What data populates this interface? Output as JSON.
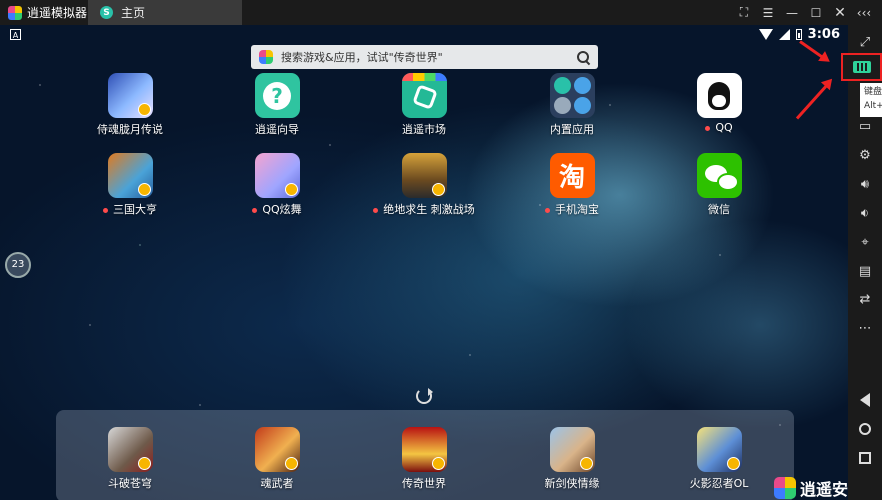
{
  "titlebar": {
    "app_name": "逍遥模拟器",
    "tab_label": "主页",
    "tab_icon_letter": "S",
    "buttons": [
      "⛶",
      "☰",
      "—",
      "☐",
      "✕",
      "‹‹‹"
    ]
  },
  "statusbar": {
    "time": "3:06",
    "left_badge": "A"
  },
  "search": {
    "placeholder": "搜索游戏&应用，试试\"传奇世界\""
  },
  "apps": [
    {
      "label": "侍魂胧月传说",
      "dot": false
    },
    {
      "label": "逍遥向导",
      "dot": false
    },
    {
      "label": "逍遥市场",
      "dot": false
    },
    {
      "label": "内置应用",
      "dot": false
    },
    {
      "label": "QQ",
      "dot": true
    },
    {
      "label": "三国大亨",
      "dot": true
    },
    {
      "label": "QQ炫舞",
      "dot": true
    },
    {
      "label": "绝地求生 刺激战场",
      "dot": true
    },
    {
      "label": "手机淘宝",
      "dot": true
    },
    {
      "label": "微信",
      "dot": false
    }
  ],
  "taobao_glyph": "淘",
  "dock": [
    {
      "label": "斗破苍穹"
    },
    {
      "label": "魂武者"
    },
    {
      "label": "传奇世界"
    },
    {
      "label": "新剑侠情缘"
    },
    {
      "label": "火影忍者OL"
    }
  ],
  "fps": "23",
  "tooltip": {
    "line1": "键盘",
    "line2": "Alt+"
  },
  "watermark": "逍遥安",
  "colors": {
    "highlight": "#ee2222",
    "keyboard_icon": "#2fd39a"
  }
}
